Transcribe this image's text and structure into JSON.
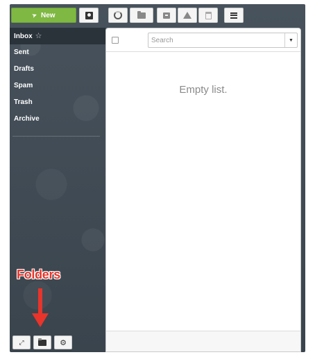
{
  "toolbar": {
    "new_label": "New",
    "icons": [
      "paper-plane-icon",
      "contacts-icon",
      "refresh-icon",
      "move-to-folder-icon",
      "archive-icon",
      "spam-warning-icon",
      "trash-icon",
      "menu-icon"
    ]
  },
  "sidebar": {
    "items": [
      {
        "label": "Inbox",
        "active": true
      },
      {
        "label": "Sent"
      },
      {
        "label": "Drafts"
      },
      {
        "label": "Spam"
      },
      {
        "label": "Trash"
      },
      {
        "label": "Archive"
      }
    ],
    "bottom_icons": [
      "expand-icon",
      "folder-icon",
      "gear-icon"
    ]
  },
  "main": {
    "search": {
      "placeholder": "Search",
      "value": ""
    },
    "empty_text": "Empty list."
  },
  "annotation": {
    "label": "Folders"
  },
  "colors": {
    "new_button": "#7fb842",
    "sidebar_bg": "#3d4750",
    "annotation": "#e8342a"
  }
}
